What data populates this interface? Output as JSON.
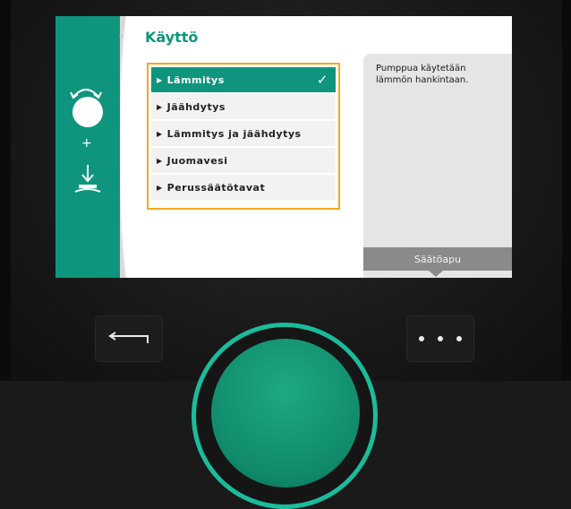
{
  "screen": {
    "title": "Käyttö",
    "side_dots": "..",
    "side_icons": [
      "rotate-arrows-icon",
      "plus-icon",
      "down-arrow-icon"
    ],
    "plus_symbol": "+"
  },
  "menu": {
    "items": [
      {
        "label": "Lämmitys",
        "selected": true
      },
      {
        "label": "Jäähdytys",
        "selected": false
      },
      {
        "label": "Lämmitys ja jäähdytys",
        "selected": false
      },
      {
        "label": "Juomavesi",
        "selected": false
      },
      {
        "label": "Perussäätötavat",
        "selected": false
      }
    ],
    "check_symbol": "✓"
  },
  "help": {
    "text": "Pumppua käytetään lämmön hankintaan.",
    "button_label": "Säätöapu"
  },
  "controls": {
    "back_icon": "back-arrow-icon",
    "context_icon": "three-dots-icon"
  },
  "colors": {
    "accent": "#0f957d",
    "highlight": "#f4a71d",
    "help_bg": "#e5e5e5",
    "help_button": "#8a8a8a"
  }
}
